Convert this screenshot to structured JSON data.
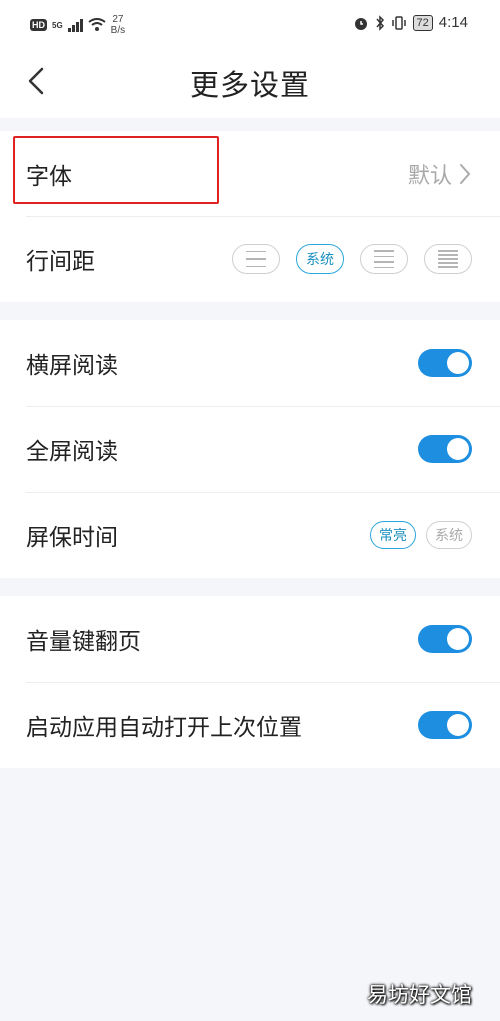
{
  "status_bar": {
    "hd": "HD",
    "network": "5G",
    "speed_value": "27",
    "speed_unit": "B/s",
    "battery": "72",
    "time": "4:14"
  },
  "header": {
    "title": "更多设置"
  },
  "font_row": {
    "label": "字体",
    "value": "默认"
  },
  "spacing_row": {
    "label": "行间距",
    "options": [
      "",
      "系统",
      "",
      ""
    ],
    "selected": "系统"
  },
  "toggles_group1": [
    {
      "label": "横屏阅读",
      "on": true
    },
    {
      "label": "全屏阅读",
      "on": true
    }
  ],
  "screen_saver_row": {
    "label": "屏保时间",
    "options": [
      "常亮",
      "系统"
    ],
    "selected": "常亮"
  },
  "toggles_group2": [
    {
      "label": "音量键翻页",
      "on": true
    },
    {
      "label": "启动应用自动打开上次位置",
      "on": true
    }
  ],
  "colors": {
    "accent": "#1e8fe0",
    "highlight_box": "#e02222"
  },
  "watermark": "易坊好文馆"
}
